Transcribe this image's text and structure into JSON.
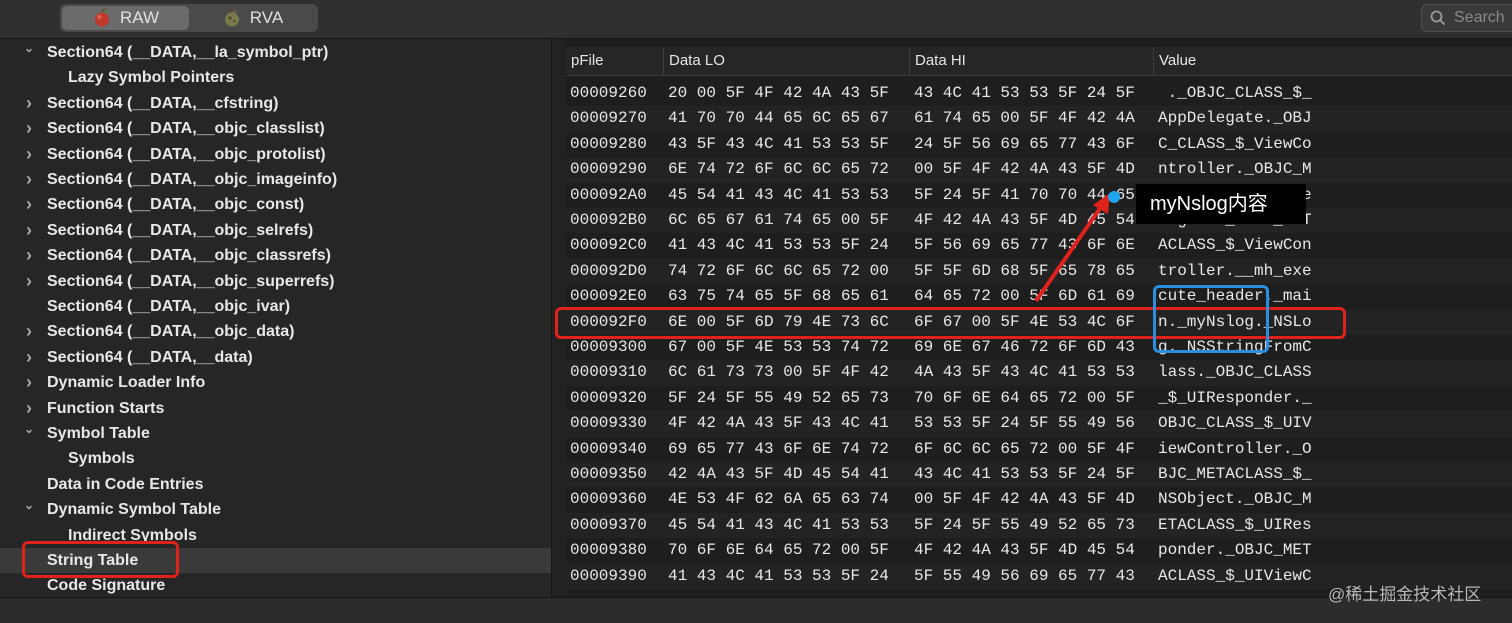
{
  "toolbar": {
    "raw_label": "RAW",
    "rva_label": "RVA",
    "search_placeholder": "Search"
  },
  "sidebar": {
    "items": [
      {
        "label": "Section64 (__DATA,__la_symbol_ptr)",
        "chevron": "down",
        "indent": 0
      },
      {
        "label": "Lazy Symbol Pointers",
        "chevron": "none",
        "indent": 1
      },
      {
        "label": "Section64 (__DATA,__cfstring)",
        "chevron": "right",
        "indent": 0
      },
      {
        "label": "Section64 (__DATA,__objc_classlist)",
        "chevron": "right",
        "indent": 0
      },
      {
        "label": "Section64 (__DATA,__objc_protolist)",
        "chevron": "right",
        "indent": 0
      },
      {
        "label": "Section64 (__DATA,__objc_imageinfo)",
        "chevron": "right",
        "indent": 0
      },
      {
        "label": "Section64 (__DATA,__objc_const)",
        "chevron": "right",
        "indent": 0
      },
      {
        "label": "Section64 (__DATA,__objc_selrefs)",
        "chevron": "right",
        "indent": 0
      },
      {
        "label": "Section64 (__DATA,__objc_classrefs)",
        "chevron": "right",
        "indent": 0
      },
      {
        "label": "Section64 (__DATA,__objc_superrefs)",
        "chevron": "right",
        "indent": 0
      },
      {
        "label": "Section64 (__DATA,__objc_ivar)",
        "chevron": "none",
        "indent": 0
      },
      {
        "label": "Section64 (__DATA,__objc_data)",
        "chevron": "right",
        "indent": 0
      },
      {
        "label": "Section64 (__DATA,__data)",
        "chevron": "right",
        "indent": 0
      },
      {
        "label": "Dynamic Loader Info",
        "chevron": "right",
        "indent": 0
      },
      {
        "label": "Function Starts",
        "chevron": "right",
        "indent": 0
      },
      {
        "label": "Symbol Table",
        "chevron": "down",
        "indent": 0
      },
      {
        "label": "Symbols",
        "chevron": "none",
        "indent": 1
      },
      {
        "label": "Data in Code Entries",
        "chevron": "none",
        "indent": 0
      },
      {
        "label": "Dynamic Symbol Table",
        "chevron": "down",
        "indent": 0
      },
      {
        "label": "Indirect Symbols",
        "chevron": "none",
        "indent": 1
      },
      {
        "label": "String Table",
        "chevron": "none",
        "indent": 0,
        "selected": true
      },
      {
        "label": "Code Signature",
        "chevron": "none",
        "indent": 0
      }
    ]
  },
  "table": {
    "headers": {
      "pfile": "pFile",
      "data_lo": "Data LO",
      "data_hi": "Data HI",
      "value": "Value"
    },
    "rows": [
      {
        "pfile": "00009260",
        "lo": "20 00 5F 4F 42 4A 43 5F",
        "hi": "43 4C 41 53 53 5F 24 5F",
        "val": " ._OBJC_CLASS_$_"
      },
      {
        "pfile": "00009270",
        "lo": "41 70 70 44 65 6C 65 67",
        "hi": "61 74 65 00 5F 4F 42 4A",
        "val": "AppDelegate._OBJ"
      },
      {
        "pfile": "00009280",
        "lo": "43 5F 43 4C 41 53 53 5F",
        "hi": "24 5F 56 69 65 77 43 6F",
        "val": "C_CLASS_$_ViewCo"
      },
      {
        "pfile": "00009290",
        "lo": "6E 74 72 6F 6C 6C 65 72",
        "hi": "00 5F 4F 42 4A 43 5F 4D",
        "val": "ntroller._OBJC_M"
      },
      {
        "pfile": "000092A0",
        "lo": "45 54 41 43 4C 41 53 53",
        "hi": "5F 24 5F 41 70 70 44 65",
        "val": "ETACLASS_$_AppDe"
      },
      {
        "pfile": "000092B0",
        "lo": "6C 65 67 61 74 65 00 5F",
        "hi": "4F 42 4A 43 5F 4D 45 54",
        "val": "legate._OBJC_MET"
      },
      {
        "pfile": "000092C0",
        "lo": "41 43 4C 41 53 53 5F 24",
        "hi": "5F 56 69 65 77 43 6F 6E",
        "val": "ACLASS_$_ViewCon"
      },
      {
        "pfile": "000092D0",
        "lo": "74 72 6F 6C 6C 65 72 00",
        "hi": "5F 5F 6D 68 5F 65 78 65",
        "val": "troller.__mh_exe"
      },
      {
        "pfile": "000092E0",
        "lo": "63 75 74 65 5F 68 65 61",
        "hi": "64 65 72 00 5F 6D 61 69",
        "val": "cute_header._mai"
      },
      {
        "pfile": "000092F0",
        "lo": "6E 00 5F 6D 79 4E 73 6C",
        "hi": "6F 67 00 5F 4E 53 4C 6F",
        "val": "n._myNslog._NSLo"
      },
      {
        "pfile": "00009300",
        "lo": "67 00 5F 4E 53 53 74 72",
        "hi": "69 6E 67 46 72 6F 6D 43",
        "val": "g._NSStringFromC"
      },
      {
        "pfile": "00009310",
        "lo": "6C 61 73 73 00 5F 4F 42",
        "hi": "4A 43 5F 43 4C 41 53 53",
        "val": "lass._OBJC_CLASS"
      },
      {
        "pfile": "00009320",
        "lo": "5F 24 5F 55 49 52 65 73",
        "hi": "70 6F 6E 64 65 72 00 5F",
        "val": "_$_UIResponder._"
      },
      {
        "pfile": "00009330",
        "lo": "4F 42 4A 43 5F 43 4C 41",
        "hi": "53 53 5F 24 5F 55 49 56",
        "val": "OBJC_CLASS_$_UIV"
      },
      {
        "pfile": "00009340",
        "lo": "69 65 77 43 6F 6E 74 72",
        "hi": "6F 6C 6C 65 72 00 5F 4F",
        "val": "iewController._O"
      },
      {
        "pfile": "00009350",
        "lo": "42 4A 43 5F 4D 45 54 41",
        "hi": "43 4C 41 53 53 5F 24 5F",
        "val": "BJC_METACLASS_$_"
      },
      {
        "pfile": "00009360",
        "lo": "4E 53 4F 62 6A 65 63 74",
        "hi": "00 5F 4F 42 4A 43 5F 4D",
        "val": "NSObject._OBJC_M"
      },
      {
        "pfile": "00009370",
        "lo": "45 54 41 43 4C 41 53 53",
        "hi": "5F 24 5F 55 49 52 65 73",
        "val": "ETACLASS_$_UIRes"
      },
      {
        "pfile": "00009380",
        "lo": "70 6F 6E 64 65 72 00 5F",
        "hi": "4F 42 4A 43 5F 4D 45 54",
        "val": "ponder._OBJC_MET"
      },
      {
        "pfile": "00009390",
        "lo": "41 43 4C 41 53 53 5F 24",
        "hi": "5F 55 49 56 69 65 77 43",
        "val": "ACLASS_$_UIViewC"
      }
    ]
  },
  "annotation": {
    "callout_text": "myNslog内容",
    "highlight_color": "#e0221d",
    "value_box_color": "#2b8fe0",
    "dot_color": "#1ea5ee"
  },
  "watermark": "@稀土掘金技术社区"
}
